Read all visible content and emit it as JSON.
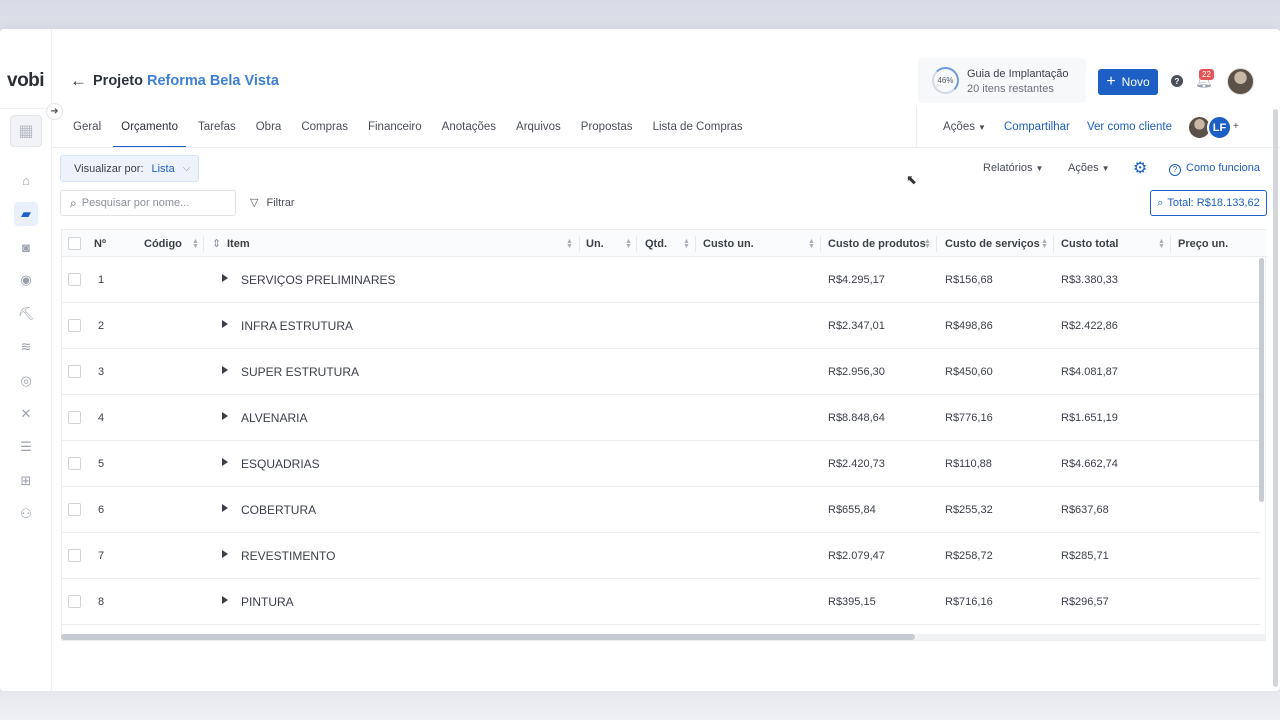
{
  "app": {
    "logo": "vobi"
  },
  "header": {
    "project_prefix": "Projeto",
    "project_name": "Reforma Bela Vista",
    "guide": {
      "percent": "46%",
      "title": "Guia de Implantação",
      "subtitle": "20 itens restantes"
    },
    "new_button": "Novo",
    "notifications_count": "22",
    "help": "?"
  },
  "tabs": [
    {
      "label": "Geral",
      "active": false
    },
    {
      "label": "Orçamento",
      "active": true
    },
    {
      "label": "Tarefas",
      "active": false
    },
    {
      "label": "Obra",
      "active": false
    },
    {
      "label": "Compras",
      "active": false
    },
    {
      "label": "Financeiro",
      "active": false
    },
    {
      "label": "Anotações",
      "active": false
    },
    {
      "label": "Arquivos",
      "active": false
    },
    {
      "label": "Propostas",
      "active": false
    },
    {
      "label": "Lista de Compras",
      "active": false
    }
  ],
  "header_actions": {
    "actions": "Ações",
    "share": "Compartilhar",
    "view_as_client": "Ver como cliente",
    "collaborator_initials": "LF",
    "add": "+"
  },
  "toolbar": {
    "view_by_label": "Visualizar por:",
    "view_by_value": "Lista",
    "reports": "Relatórios",
    "actions": "Ações",
    "how_it_works": "Como funciona",
    "search_placeholder": "Pesquisar por nome...",
    "filter": "Filtrar",
    "total": "Total: R$18.133,62"
  },
  "table": {
    "columns": [
      "Nº",
      "Código",
      "Item",
      "Un.",
      "Qtd.",
      "Custo un.",
      "Custo de produtos",
      "Custo de serviços",
      "Custo total",
      "Preço un."
    ],
    "rows": [
      {
        "n": "1",
        "item": "SERVIÇOS PRELIMINARES",
        "produtos": "R$4.295,17",
        "servicos": "R$156,68",
        "total": "R$3.380,33"
      },
      {
        "n": "2",
        "item": "INFRA ESTRUTURA",
        "produtos": "R$2.347,01",
        "servicos": "R$498,86",
        "total": "R$2.422,86"
      },
      {
        "n": "3",
        "item": "SUPER ESTRUTURA",
        "produtos": "R$2.956,30",
        "servicos": "R$450,60",
        "total": "R$4.081,87"
      },
      {
        "n": "4",
        "item": "ALVENARIA",
        "produtos": "R$8.848,64",
        "servicos": "R$776,16",
        "total": "R$1.651,19"
      },
      {
        "n": "5",
        "item": "ESQUADRIAS",
        "produtos": "R$2.420,73",
        "servicos": "R$110,88",
        "total": "R$4.662,74"
      },
      {
        "n": "6",
        "item": "COBERTURA",
        "produtos": "R$655,84",
        "servicos": "R$255,32",
        "total": "R$637,68"
      },
      {
        "n": "7",
        "item": "REVESTIMENTO",
        "produtos": "R$2.079,47",
        "servicos": "R$258,72",
        "total": "R$285,71"
      },
      {
        "n": "8",
        "item": "PINTURA",
        "produtos": "R$395,15",
        "servicos": "R$716,16",
        "total": "R$296,57"
      }
    ]
  },
  "sidebar_icons": [
    "home-icon",
    "folder-icon",
    "camera-icon",
    "dollar-coin-icon",
    "worker-icon",
    "coins-stack-icon",
    "money-icon",
    "tools-icon",
    "list-icon",
    "apps-add-icon",
    "users-icon"
  ],
  "colors": {
    "accent": "#1d5fc4",
    "link": "#3d7fd4",
    "badge": "#e45454"
  }
}
